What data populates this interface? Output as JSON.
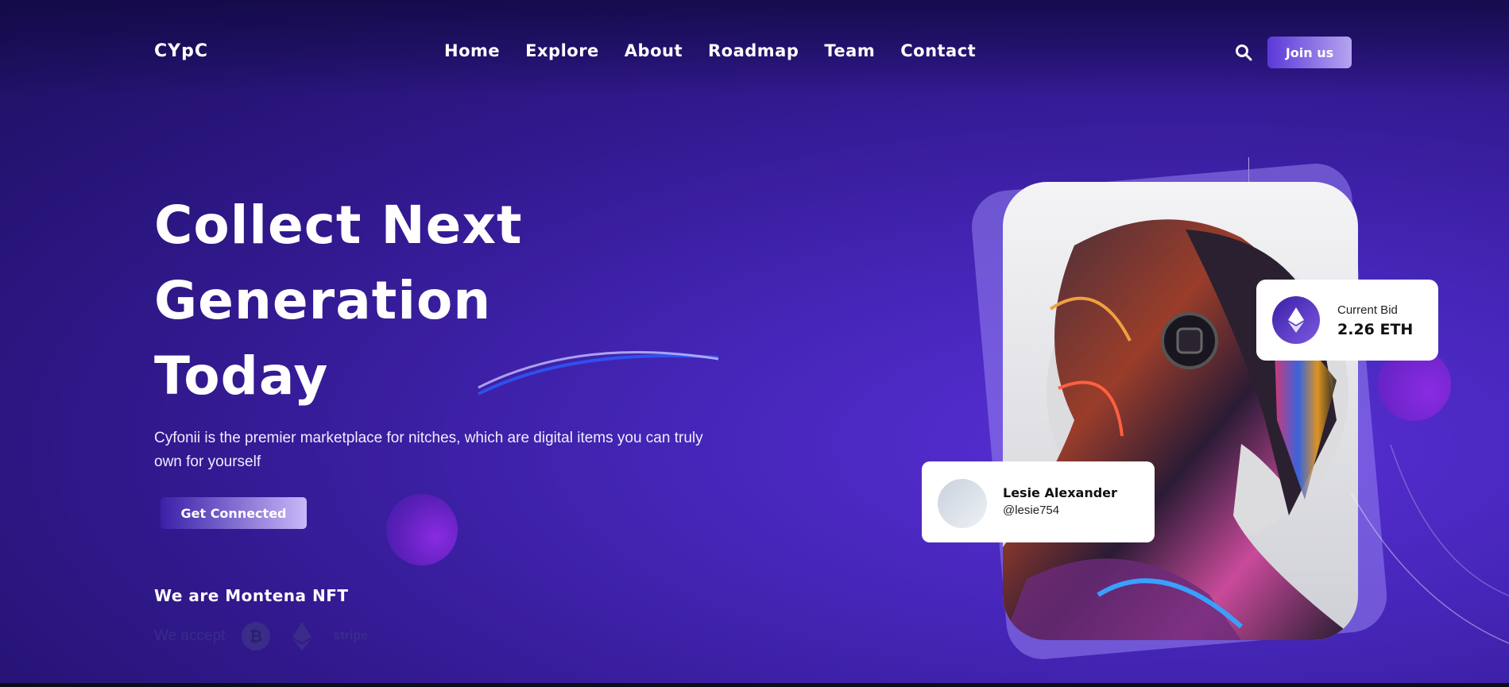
{
  "header": {
    "logo": "CYpC",
    "nav": [
      "Home",
      "Explore",
      "About",
      "Roadmap",
      "Team",
      "Contact"
    ],
    "join_label": "Join us"
  },
  "hero": {
    "headline_lines": [
      "Collect Next",
      "Generation",
      "Today"
    ],
    "description": "Cyfonii is the premier marketplace for nitches, which are digital items you can truly own for yourself",
    "cta_label": "Get Connected",
    "subheading": "We are Montena NFT",
    "accept_label": "We accept",
    "payment_icons": [
      "bitcoin-icon",
      "ethereum-icon",
      "stripe-logo"
    ],
    "stripe_text": "stripe"
  },
  "showcase": {
    "bid": {
      "label": "Current Bid",
      "value": "2.26 ETH"
    },
    "creator": {
      "name": "Lesie Alexander",
      "handle": "@lesie754"
    }
  },
  "colors": {
    "accent": "#5a38d8",
    "background_dark": "#1c0f5c",
    "background_light": "#5a2fd6"
  }
}
